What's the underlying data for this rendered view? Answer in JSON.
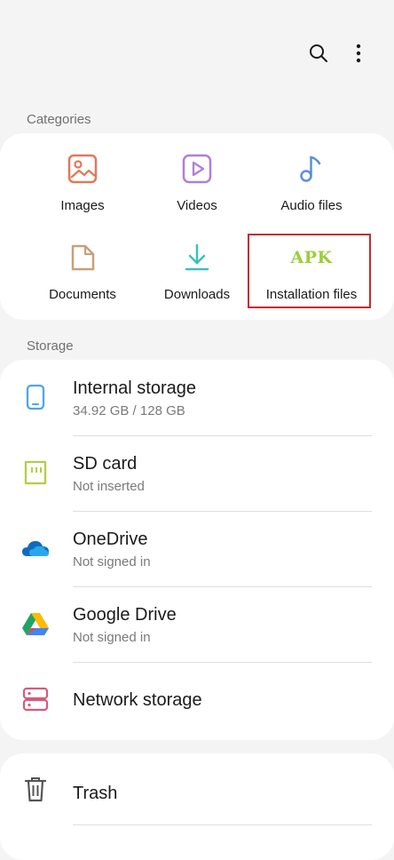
{
  "categories": {
    "label": "Categories",
    "items": [
      {
        "label": "Images",
        "icon": "image-icon",
        "color": "#e0785a"
      },
      {
        "label": "Videos",
        "icon": "video-icon",
        "color": "#b07fd6"
      },
      {
        "label": "Audio files",
        "icon": "music-note-icon",
        "color": "#5b8fd8"
      },
      {
        "label": "Documents",
        "icon": "document-icon",
        "color": "#c8a07a"
      },
      {
        "label": "Downloads",
        "icon": "download-icon",
        "color": "#3bbfbf"
      },
      {
        "label": "Installation files",
        "icon": "apk-icon",
        "icon_text": "APK",
        "color": "#9bcd3c"
      }
    ]
  },
  "storage": {
    "label": "Storage",
    "items": [
      {
        "title": "Internal storage",
        "subtitle": "34.92 GB / 128 GB",
        "icon": "phone-icon",
        "color": "#4da6e8"
      },
      {
        "title": "SD card",
        "subtitle": "Not inserted",
        "icon": "sd-card-icon",
        "color": "#b7cc42"
      },
      {
        "title": "OneDrive",
        "subtitle": "Not signed in",
        "icon": "onedrive-icon",
        "color": "#0f6cbd"
      },
      {
        "title": "Google Drive",
        "subtitle": "Not signed in",
        "icon": "google-drive-icon",
        "color": "#1fa463"
      },
      {
        "title": "Network storage",
        "subtitle": "",
        "icon": "server-icon",
        "color": "#d85a7a"
      }
    ]
  },
  "trash": {
    "title": "Trash",
    "icon": "trash-icon"
  },
  "highlight_color": "#c8282e"
}
